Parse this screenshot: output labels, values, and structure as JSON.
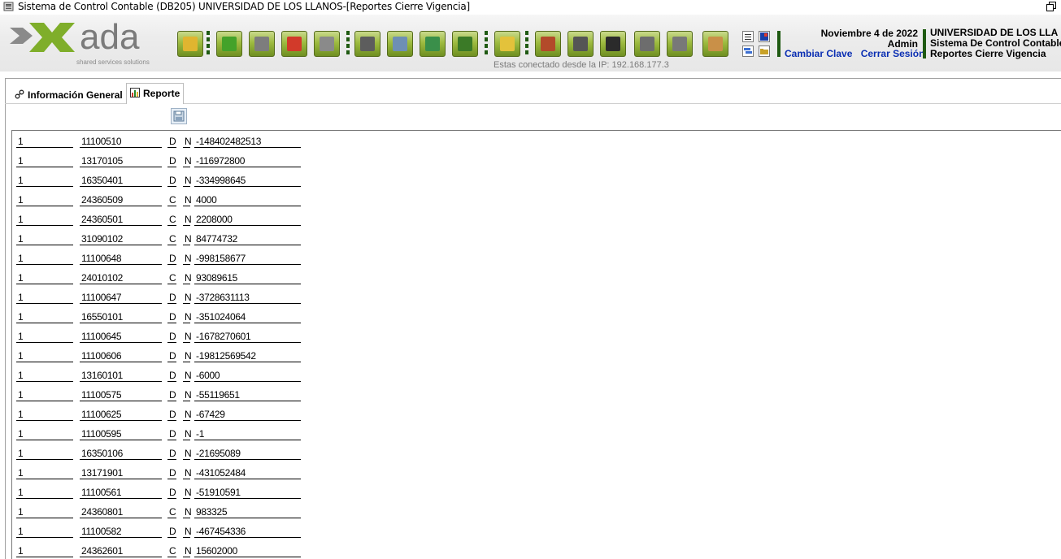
{
  "window": {
    "title": "Sistema de Control Contable (DB205) UNIVERSIDAD DE LOS LLANOS-[Reportes Cierre Vigencia]"
  },
  "logo": {
    "text": "ada",
    "tagline": "shared services solutions"
  },
  "toolbar": {
    "buttons": [
      {
        "name": "open-folder",
        "icon": "folder-icon",
        "color": "#e0b530"
      },
      {
        "name": "new",
        "icon": "new-doc-icon",
        "color": "#44a22a"
      },
      {
        "name": "save",
        "icon": "floppy-icon",
        "color": "#7d7d7d"
      },
      {
        "name": "delete",
        "icon": "delete-icon",
        "color": "#d23a2a"
      },
      {
        "name": "undo",
        "icon": "undo-icon",
        "color": "#8a8a8a"
      },
      {
        "name": "print",
        "icon": "printer-icon",
        "color": "#5d5d5d"
      },
      {
        "name": "search",
        "icon": "magnifier-icon",
        "color": "#6e8fb5"
      },
      {
        "name": "export",
        "icon": "export-icon",
        "color": "#3a8f4a"
      },
      {
        "name": "basket",
        "icon": "basket-icon",
        "color": "#3b7a27"
      },
      {
        "name": "lock",
        "icon": "padlock-icon",
        "color": "#e3c23b"
      },
      {
        "name": "money",
        "icon": "money-icon",
        "color": "#b34a2a"
      },
      {
        "name": "camera",
        "icon": "camera-icon",
        "color": "#555555"
      },
      {
        "name": "grid",
        "icon": "grid-icon",
        "color": "#2b2b2b"
      },
      {
        "name": "cart",
        "icon": "cart-icon",
        "color": "#6d6d6d"
      },
      {
        "name": "reload",
        "icon": "reload-icon",
        "color": "#787878"
      },
      {
        "name": "users",
        "icon": "users-icon",
        "color": "#c99048"
      }
    ],
    "ip_text": "Estas conectado desde la IP: 192.168.177.3"
  },
  "session": {
    "date": "Noviembre 4 de 2022",
    "user": "Admin",
    "change_password": "Cambiar Clave",
    "logout": "Cerrar Sesión"
  },
  "org": {
    "line1": "UNIVERSIDAD DE LOS LLA",
    "line2": "Sistema De Control Contable",
    "line3": "Reportes Cierre Vigencia"
  },
  "tabs": [
    {
      "label": "Información General",
      "icon": "link-icon"
    },
    {
      "label": "Reporte",
      "icon": "bar-chart-icon"
    }
  ],
  "rows": [
    {
      "c1": "1",
      "c2": "11100510",
      "c3": "D",
      "c4": "N",
      "c5": "-148402482513"
    },
    {
      "c1": "1",
      "c2": "13170105",
      "c3": "D",
      "c4": "N",
      "c5": "-116972800"
    },
    {
      "c1": "1",
      "c2": "16350401",
      "c3": "D",
      "c4": "N",
      "c5": "-334998645"
    },
    {
      "c1": "1",
      "c2": "24360509",
      "c3": "C",
      "c4": "N",
      "c5": "4000"
    },
    {
      "c1": "1",
      "c2": "24360501",
      "c3": "C",
      "c4": "N",
      "c5": "2208000"
    },
    {
      "c1": "1",
      "c2": "31090102",
      "c3": "C",
      "c4": "N",
      "c5": "84774732"
    },
    {
      "c1": "1",
      "c2": "11100648",
      "c3": "D",
      "c4": "N",
      "c5": "-998158677"
    },
    {
      "c1": "1",
      "c2": "24010102",
      "c3": "C",
      "c4": "N",
      "c5": "93089615"
    },
    {
      "c1": "1",
      "c2": "11100647",
      "c3": "D",
      "c4": "N",
      "c5": "-3728631113"
    },
    {
      "c1": "1",
      "c2": "16550101",
      "c3": "D",
      "c4": "N",
      "c5": "-351024064"
    },
    {
      "c1": "1",
      "c2": "11100645",
      "c3": "D",
      "c4": "N",
      "c5": "-1678270601"
    },
    {
      "c1": "1",
      "c2": "11100606",
      "c3": "D",
      "c4": "N",
      "c5": "-19812569542"
    },
    {
      "c1": "1",
      "c2": "13160101",
      "c3": "D",
      "c4": "N",
      "c5": "-6000"
    },
    {
      "c1": "1",
      "c2": "11100575",
      "c3": "D",
      "c4": "N",
      "c5": "-55119651"
    },
    {
      "c1": "1",
      "c2": "11100625",
      "c3": "D",
      "c4": "N",
      "c5": "-67429"
    },
    {
      "c1": "1",
      "c2": "11100595",
      "c3": "D",
      "c4": "N",
      "c5": "-1"
    },
    {
      "c1": "1",
      "c2": "16350106",
      "c3": "D",
      "c4": "N",
      "c5": "-21695089"
    },
    {
      "c1": "1",
      "c2": "13171901",
      "c3": "D",
      "c4": "N",
      "c5": "-431052484"
    },
    {
      "c1": "1",
      "c2": "11100561",
      "c3": "D",
      "c4": "N",
      "c5": "-51910591"
    },
    {
      "c1": "1",
      "c2": "24360801",
      "c3": "C",
      "c4": "N",
      "c5": "983325"
    },
    {
      "c1": "1",
      "c2": "11100582",
      "c3": "D",
      "c4": "N",
      "c5": "-467454336"
    },
    {
      "c1": "1",
      "c2": "24362601",
      "c3": "C",
      "c4": "N",
      "c5": "15602000"
    }
  ]
}
